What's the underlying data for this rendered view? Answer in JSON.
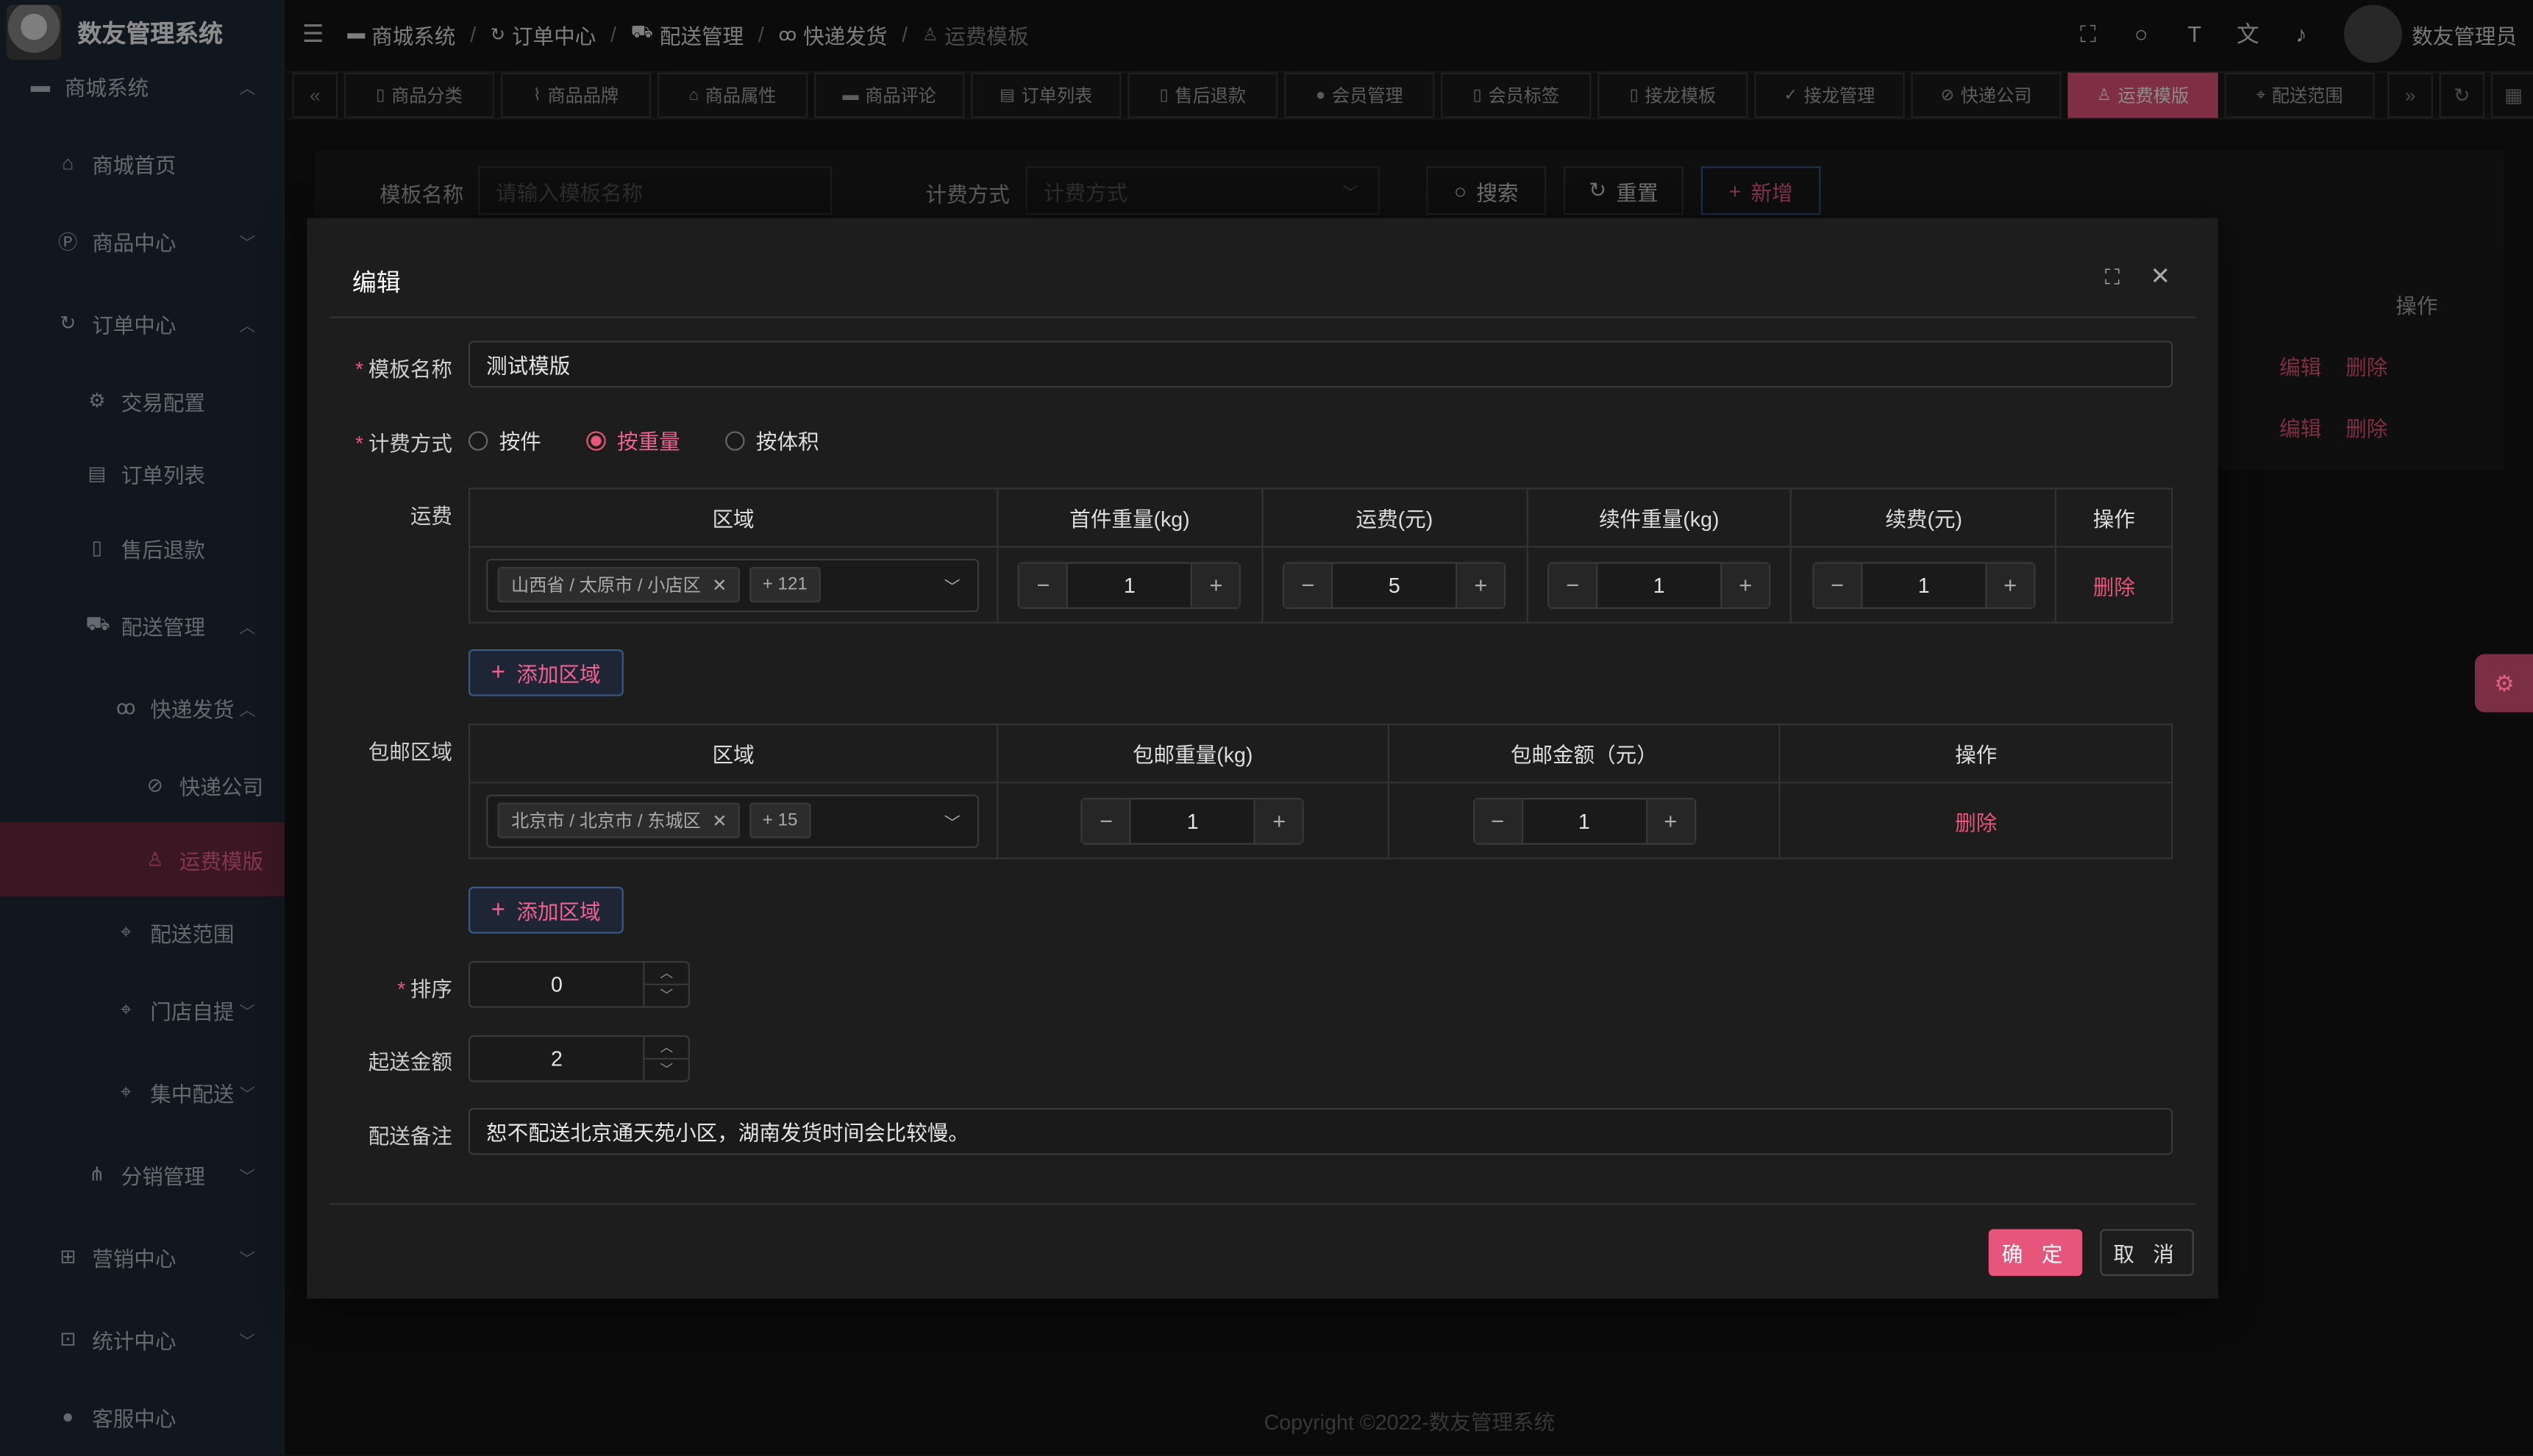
{
  "app": {
    "title": "数友管理系统",
    "user": "数友管理员",
    "footer": "Copyright ©2022-数友管理系统"
  },
  "sidebar": {
    "top": {
      "label": "商城系统"
    },
    "items": [
      {
        "label": "商城首页"
      },
      {
        "label": "商品中心"
      },
      {
        "label": "订单中心"
      },
      {
        "label": "交易配置"
      },
      {
        "label": "订单列表"
      },
      {
        "label": "售后退款"
      },
      {
        "label": "配送管理"
      },
      {
        "label": "快递发货"
      },
      {
        "label": "快递公司"
      },
      {
        "label": "运费模版"
      },
      {
        "label": "配送范围"
      },
      {
        "label": "门店自提"
      },
      {
        "label": "集中配送"
      },
      {
        "label": "分销管理"
      },
      {
        "label": "营销中心"
      },
      {
        "label": "统计中心"
      },
      {
        "label": "客服中心"
      }
    ]
  },
  "breadcrumb": [
    "商城系统",
    "订单中心",
    "配送管理",
    "快递发货",
    "运费模板"
  ],
  "tabs": [
    "商品分类",
    "商品品牌",
    "商品属性",
    "商品评论",
    "订单列表",
    "售后退款",
    "会员管理",
    "会员标签",
    "接龙模板",
    "接龙管理",
    "快递公司",
    "运费模版",
    "配送范围"
  ],
  "search": {
    "name_label": "模板名称",
    "name_placeholder": "请输入模板名称",
    "method_label": "计费方式",
    "method_placeholder": "计费方式",
    "search_btn": "搜索",
    "reset_btn": "重置",
    "add_btn": "新增"
  },
  "bg_table": {
    "header": "操作",
    "edit": "编辑",
    "delete": "删除"
  },
  "dialog": {
    "title": "编辑",
    "name_label": "模板名称",
    "name_value": "测试模版",
    "method_label": "计费方式",
    "methods": [
      "按件",
      "按重量",
      "按体积"
    ],
    "selected_method": "按重量",
    "freight_label": "运费",
    "freight_headers": [
      "区域",
      "首件重量(kg)",
      "运费(元)",
      "续件重量(kg)",
      "续费(元)",
      "操作"
    ],
    "freight_row": {
      "region_tag": "山西省 / 太原市 / 小店区",
      "region_more": "+ 121",
      "first_weight": "1",
      "freight": "5",
      "continue_weight": "1",
      "continue_fee": "1",
      "action": "删除"
    },
    "add_region": "添加区域",
    "free_label": "包邮区域",
    "free_headers": [
      "区域",
      "包邮重量(kg)",
      "包邮金额（元）",
      "操作"
    ],
    "free_row": {
      "region_tag": "北京市 / 北京市 / 东城区",
      "region_more": "+ 15",
      "weight": "1",
      "amount": "1",
      "action": "删除"
    },
    "sort_label": "排序",
    "sort_value": "0",
    "min_label": "起送金额",
    "min_value": "2",
    "remark_label": "配送备注",
    "remark_value": "恕不配送北京通天苑小区，湖南发货时间会比较慢。",
    "ok": "确 定",
    "cancel": "取 消"
  }
}
